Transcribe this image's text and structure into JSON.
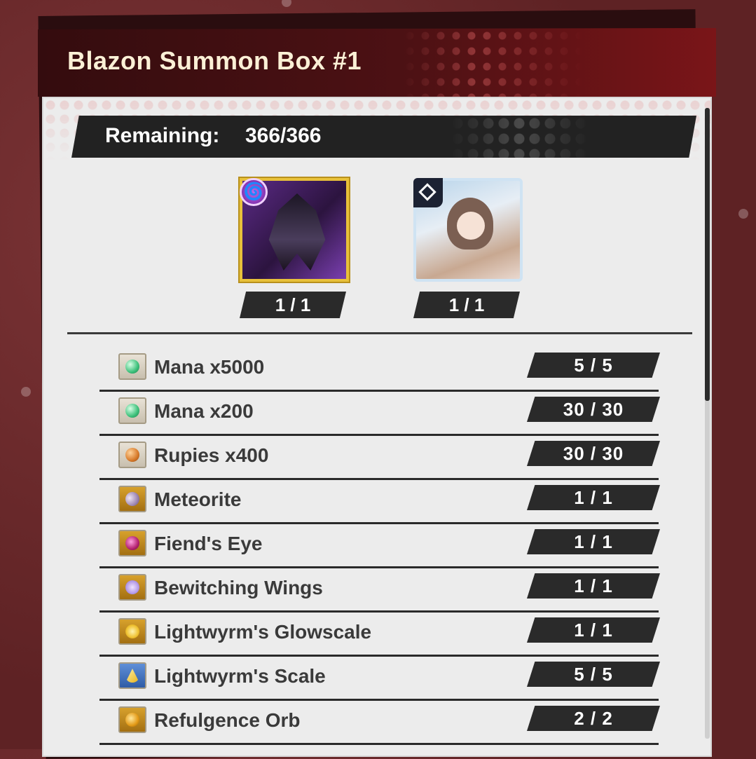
{
  "panel": {
    "title": "Blazon Summon Box #1"
  },
  "remaining": {
    "label": "Remaining:",
    "value": "366/366"
  },
  "featured": [
    {
      "count": "1 / 1",
      "icon": "shadow-dragon-portrait",
      "badge": "shadow-element-icon"
    },
    {
      "count": "1 / 1",
      "icon": "adventurer-girl-portrait",
      "badge": "blazon-type-icon"
    }
  ],
  "items": [
    {
      "name": "Mana x5000",
      "count": "5  /  5",
      "icon": "mana-icon"
    },
    {
      "name": "Mana x200",
      "count": "30  /  30",
      "icon": "mana-icon"
    },
    {
      "name": "Rupies x400",
      "count": "30  /  30",
      "icon": "rupies-icon"
    },
    {
      "name": "Meteorite",
      "count": "1  /  1",
      "icon": "meteorite-icon"
    },
    {
      "name": "Fiend's Eye",
      "count": "1  /  1",
      "icon": "fiends-eye-icon"
    },
    {
      "name": "Bewitching Wings",
      "count": "1  /  1",
      "icon": "bewitching-wings-icon"
    },
    {
      "name": "Lightwyrm's Glowscale",
      "count": "1  /  1",
      "icon": "glowscale-icon"
    },
    {
      "name": "Lightwyrm's Scale",
      "count": "5  /  5",
      "icon": "scale-icon"
    },
    {
      "name": "Refulgence Orb",
      "count": "2  /  2",
      "icon": "refulgence-orb-icon"
    }
  ],
  "colors": {
    "header": "#4d1114",
    "body": "#ececec",
    "pill": "#2a2a2a",
    "gold_frame": "#e8c13a"
  }
}
